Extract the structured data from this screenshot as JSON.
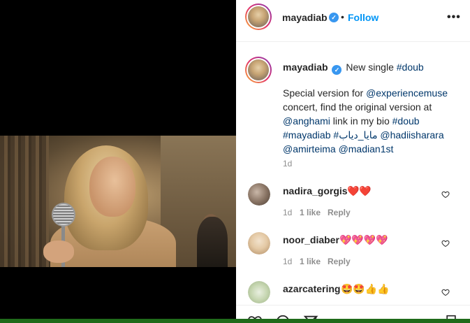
{
  "post": {
    "username": "mayadiab",
    "verified_glyph": "✓",
    "dot": "•",
    "follow_label": "Follow",
    "more_label": "•••"
  },
  "caption": {
    "username": "mayadiab",
    "lead_text": "New single ",
    "lead_tag": "#doub",
    "body_prefix": "Special version for ",
    "mention_experience": "@experiencemuse",
    "body_mid": " concert, find the original version at ",
    "mention_anghami": "@anghami",
    "body_mid2": " link in my bio ",
    "tag_doub": "#doub",
    "tag_mayadiab": "#mayadiab",
    "tag_arabic": "#مايا_دياب",
    "mention_hadi": "@hadiisharara",
    "mention_amir": "@amirteima",
    "mention_madian": "@madian1st",
    "time": "1d"
  },
  "comments": [
    {
      "username": "nadira_gorgis",
      "text": "❤️❤️",
      "time": "1d",
      "likes": "1 like",
      "reply": "Reply"
    },
    {
      "username": "noor_diaber",
      "text": "💖💖💖💖",
      "time": "1d",
      "likes": "1 like",
      "reply": "Reply"
    },
    {
      "username": "azarcatering",
      "text": "🤩🤩👍👍"
    }
  ],
  "icons": {
    "heart": "heart-outline-icon",
    "more": "more-options-icon",
    "verified": "verified-badge-icon"
  },
  "colors": {
    "follow": "#0095f6",
    "link": "#00376b",
    "verified": "#3897f0",
    "heart_emoji": "#e0245e",
    "taskbar": "#1f6b1a"
  }
}
